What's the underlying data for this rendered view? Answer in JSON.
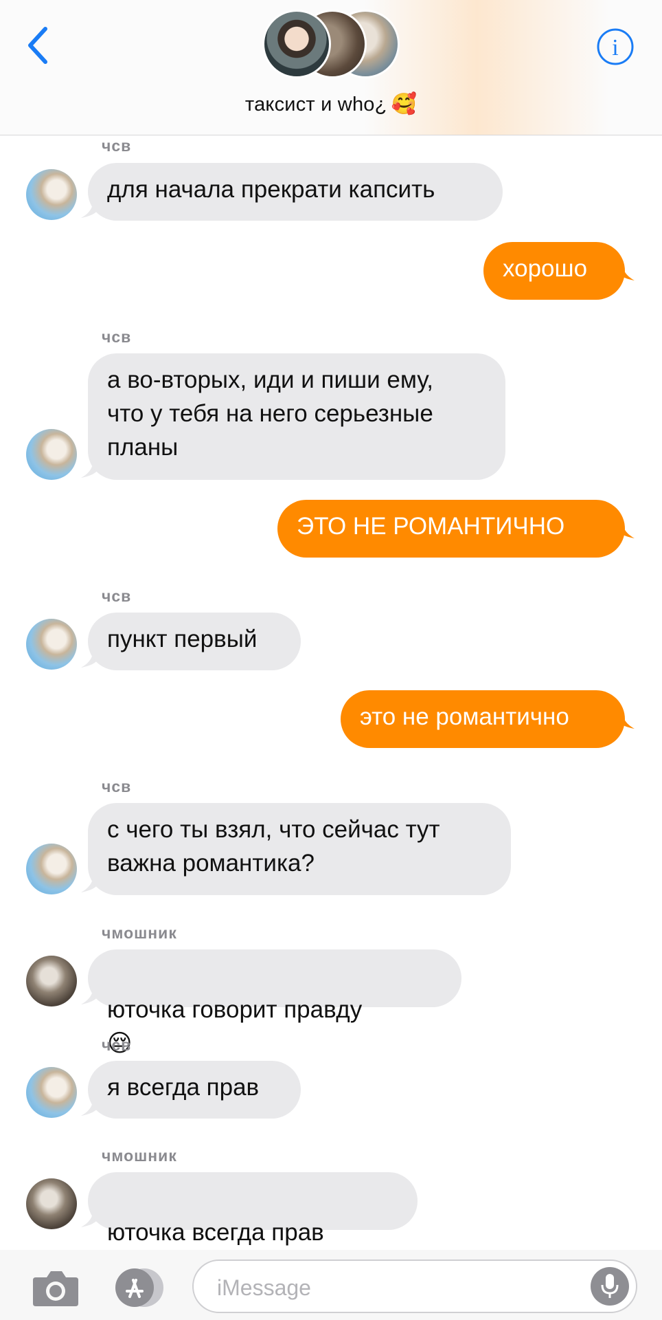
{
  "header": {
    "group_name": "таксист и who¿",
    "group_emoji": "🥰",
    "back_icon": "chevron-left-icon",
    "info_icon": "info-icon"
  },
  "colors": {
    "accent": "#1a7cf5",
    "outgoing_bubble": "#ff8a00",
    "incoming_bubble": "#e9e9eb"
  },
  "messages": [
    {
      "direction": "in",
      "sender": "чсв",
      "text": "для начала прекрати капсить"
    },
    {
      "direction": "out",
      "text": "хорошо"
    },
    {
      "direction": "in",
      "sender": "чсв",
      "text": "а во-вторых, иди и пиши ему,\nчто у тебя на него серьезные\nпланы"
    },
    {
      "direction": "out",
      "text": "ЭТО НЕ РОМАНТИЧНО"
    },
    {
      "direction": "in",
      "sender": "чсв",
      "text": "пункт первый"
    },
    {
      "direction": "out",
      "text": "это не романтично"
    },
    {
      "direction": "in",
      "sender": "чсв",
      "text": "с чего ты взял, что сейчас тут\nважна романтика?"
    },
    {
      "direction": "in",
      "sender": "чмошник",
      "text": "юточка говорит правду",
      "emoji": "😔"
    },
    {
      "direction": "in",
      "sender": "чсв",
      "text": "я всегда прав"
    },
    {
      "direction": "in",
      "sender": "чмошник",
      "text": "юточка всегда прав",
      "emoji": "😔"
    }
  ],
  "input_bar": {
    "placeholder": "iMessage",
    "value": "",
    "camera_icon": "camera-icon",
    "apps_icon": "app-store-icon",
    "mic_icon": "microphone-icon"
  }
}
